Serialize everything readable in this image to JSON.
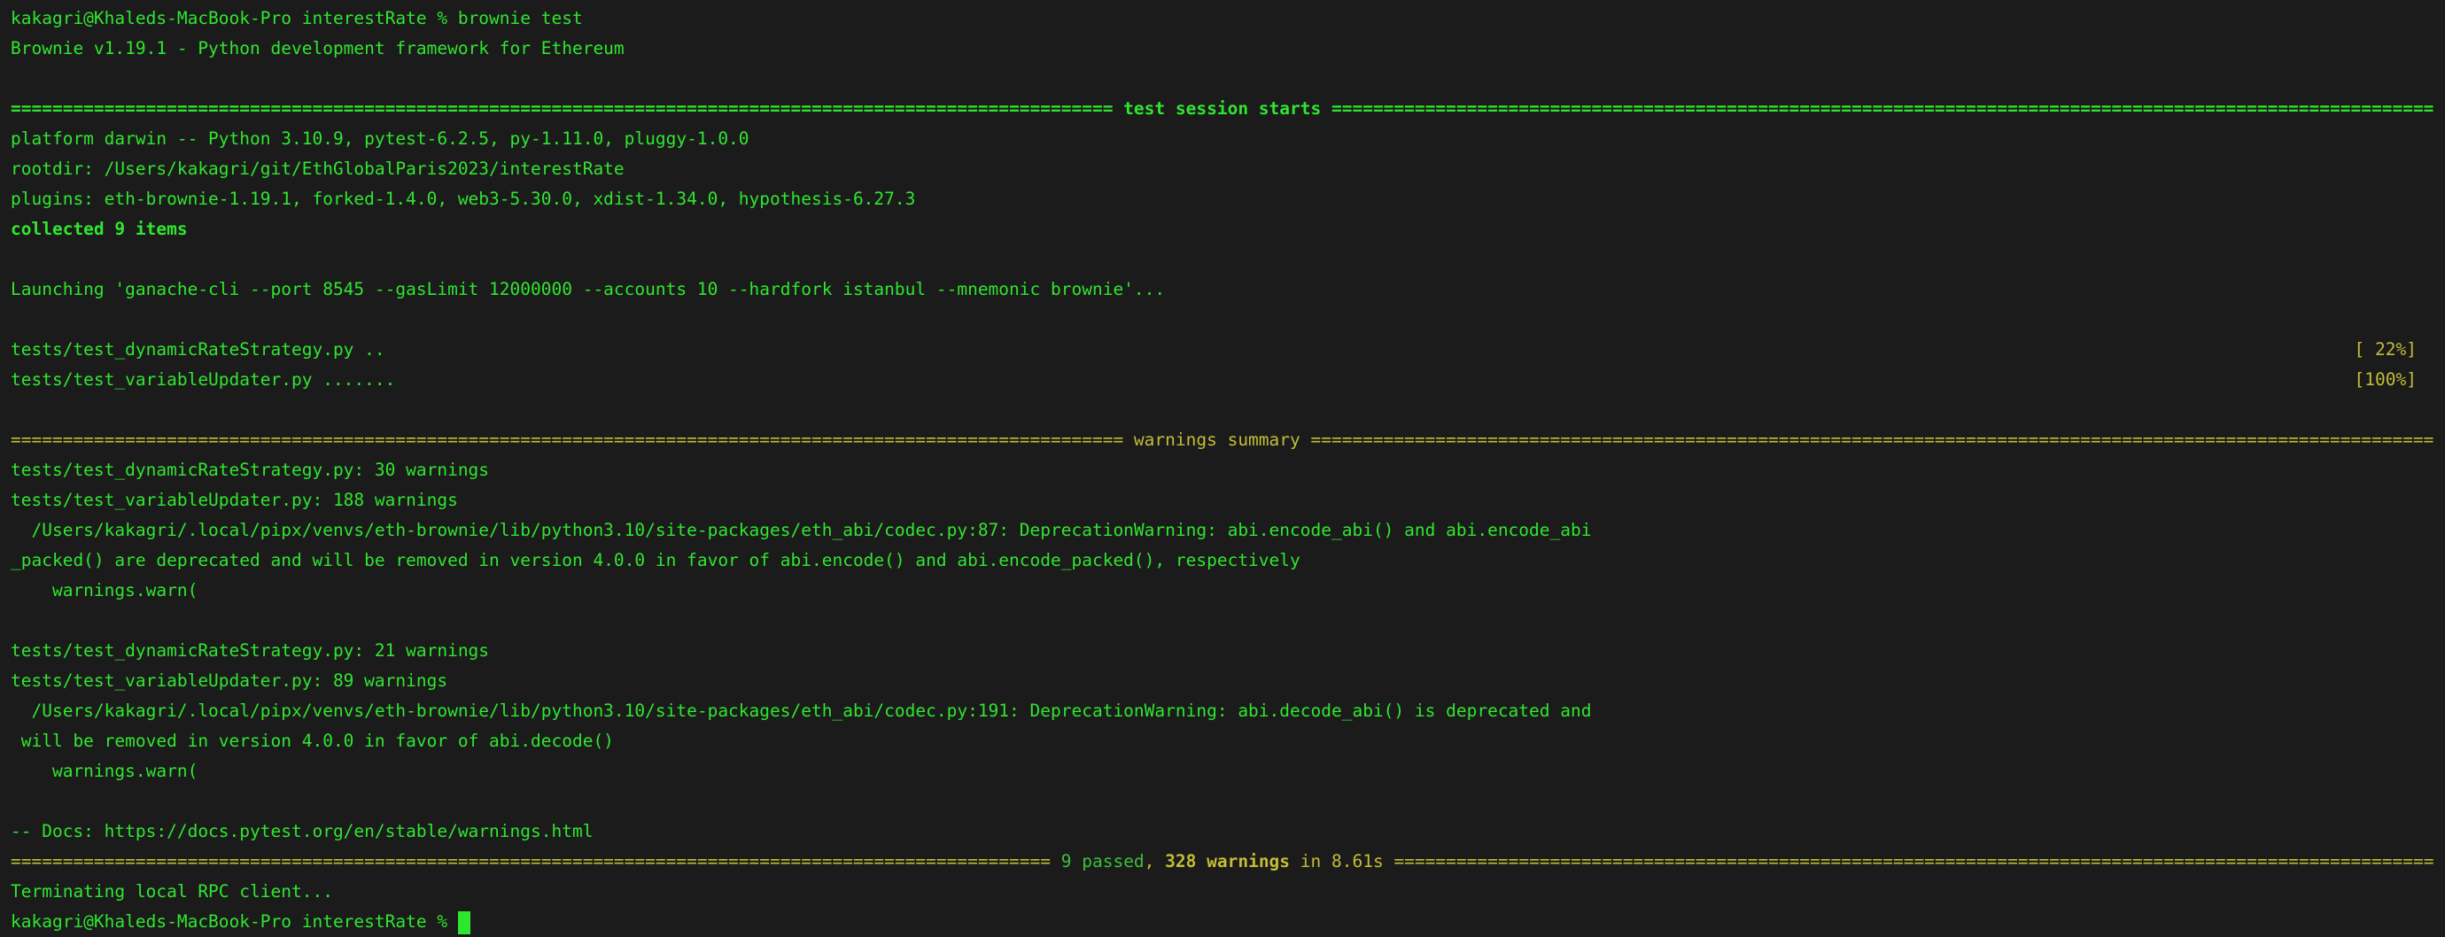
{
  "window": {
    "type": "terminal"
  },
  "colors": {
    "background": "#1b1b1b",
    "green": "#2fe62f",
    "dark_green": "#3cbf3c",
    "yellow": "#c3bd35"
  },
  "terminal": {
    "lines": [
      {
        "segments": [
          {
            "text": "kakagri@Khaleds-MacBook-Pro interestRate % brownie test",
            "style": "g"
          }
        ]
      },
      {
        "segments": [
          {
            "text": "Brownie v1.19.1 - Python development framework for Ethereum",
            "style": "g"
          }
        ]
      },
      {
        "segments": []
      },
      {
        "segments": [
          {
            "text": "========================================================================================================== test session starts ==========================================================================================================",
            "style": "g b"
          }
        ]
      },
      {
        "segments": [
          {
            "text": "platform darwin -- Python 3.10.9, pytest-6.2.5, py-1.11.0, pluggy-1.0.0",
            "style": "g"
          }
        ]
      },
      {
        "segments": [
          {
            "text": "rootdir: /Users/kakagri/git/EthGlobalParis2023/interestRate",
            "style": "g"
          }
        ]
      },
      {
        "segments": [
          {
            "text": "plugins: eth-brownie-1.19.1, forked-1.4.0, web3-5.30.0, xdist-1.34.0, hypothesis-6.27.3",
            "style": "g"
          }
        ]
      },
      {
        "segments": [
          {
            "text": "collected 9 items",
            "style": "g b"
          }
        ]
      },
      {
        "segments": []
      },
      {
        "segments": [
          {
            "text": "Launching 'ganache-cli --port 8545 --gasLimit 12000000 --accounts 10 --hardfork istanbul --mnemonic brownie'...",
            "style": "g"
          }
        ]
      },
      {
        "segments": []
      },
      {
        "segments": [
          {
            "text": "tests/test_dynamicRateStrategy.py ..",
            "style": "g"
          }
        ],
        "progress": "[ 22%]"
      },
      {
        "segments": [
          {
            "text": "tests/test_variableUpdater.py .......",
            "style": "g"
          }
        ],
        "progress": "[100%]"
      },
      {
        "segments": []
      },
      {
        "segments": [
          {
            "text": "=========================================================================================================== warnings summary ============================================================================================================",
            "style": "y"
          }
        ]
      },
      {
        "segments": [
          {
            "text": "tests/test_dynamicRateStrategy.py: 30 warnings",
            "style": "g"
          }
        ]
      },
      {
        "segments": [
          {
            "text": "tests/test_variableUpdater.py: 188 warnings",
            "style": "g"
          }
        ]
      },
      {
        "segments": [
          {
            "text": "  /Users/kakagri/.local/pipx/venvs/eth-brownie/lib/python3.10/site-packages/eth_abi/codec.py:87: DeprecationWarning: abi.encode_abi() and abi.encode_abi",
            "style": "g"
          }
        ]
      },
      {
        "segments": [
          {
            "text": "_packed() are deprecated and will be removed in version 4.0.0 in favor of abi.encode() and abi.encode_packed(), respectively",
            "style": "g"
          }
        ]
      },
      {
        "segments": [
          {
            "text": "    warnings.warn(",
            "style": "g"
          }
        ]
      },
      {
        "segments": []
      },
      {
        "segments": [
          {
            "text": "tests/test_dynamicRateStrategy.py: 21 warnings",
            "style": "g"
          }
        ]
      },
      {
        "segments": [
          {
            "text": "tests/test_variableUpdater.py: 89 warnings",
            "style": "g"
          }
        ]
      },
      {
        "segments": [
          {
            "text": "  /Users/kakagri/.local/pipx/venvs/eth-brownie/lib/python3.10/site-packages/eth_abi/codec.py:191: DeprecationWarning: abi.decode_abi() is deprecated and",
            "style": "g"
          }
        ]
      },
      {
        "segments": [
          {
            "text": " will be removed in version 4.0.0 in favor of abi.decode()",
            "style": "g"
          }
        ]
      },
      {
        "segments": [
          {
            "text": "    warnings.warn(",
            "style": "g"
          }
        ]
      },
      {
        "segments": []
      },
      {
        "segments": [
          {
            "text": "-- Docs: https://docs.pytest.org/en/stable/warnings.html",
            "style": "g"
          }
        ]
      },
      {
        "segments": [
          {
            "text": "==================================================================================================== ",
            "style": "y"
          },
          {
            "text": "9 passed",
            "style": "dg"
          },
          {
            "text": ", ",
            "style": "y"
          },
          {
            "text": "328 warnings",
            "style": "y b"
          },
          {
            "text": " in 8.61s ====================================================================================================",
            "style": "y"
          }
        ]
      },
      {
        "segments": [
          {
            "text": "Terminating local RPC client...",
            "style": "g"
          }
        ]
      },
      {
        "segments": [
          {
            "text": "kakagri@Khaleds-MacBook-Pro interestRate % ",
            "style": "g"
          }
        ],
        "cursor": true
      }
    ]
  }
}
